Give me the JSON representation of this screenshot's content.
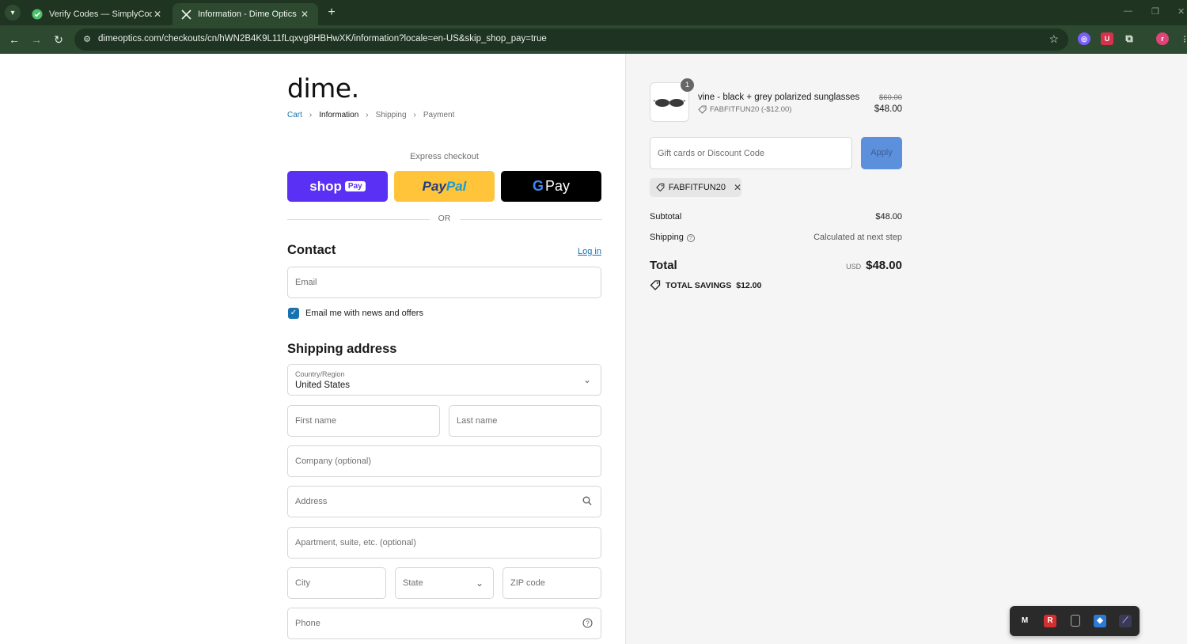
{
  "browser": {
    "tabs": [
      {
        "title": "Verify Codes — SimplyCodes",
        "favicon": "simplycodes-check-icon",
        "active": false
      },
      {
        "title": "Information - Dime Optics - Ch",
        "favicon": "x-logo-icon",
        "active": true
      }
    ],
    "url": "dimeoptics.com/checkouts/cn/hWN2B4K9L11fLqxvg8HBHwXK/information?locale=en-US&skip_shop_pay=true",
    "profile_initial": "r"
  },
  "checkout": {
    "logo": "dime.",
    "breadcrumbs": [
      "Cart",
      "Information",
      "Shipping",
      "Payment"
    ],
    "express_label": "Express checkout",
    "express": {
      "shop_word": "shop",
      "shop_badge": "Pay",
      "paypal_a": "Pay",
      "paypal_b": "Pal",
      "gpay_word": "Pay"
    },
    "or_label": "OR",
    "contact": {
      "heading": "Contact",
      "login_label": "Log in",
      "email_placeholder": "Email",
      "newsletter_label": "Email me with news and offers",
      "newsletter_checked": true
    },
    "shipping": {
      "heading": "Shipping address",
      "country_label": "Country/Region",
      "country_value": "United States",
      "first_name": "First name",
      "last_name": "Last name",
      "company": "Company (optional)",
      "address": "Address",
      "apartment": "Apartment, suite, etc. (optional)",
      "city": "City",
      "state": "State",
      "zip": "ZIP code",
      "phone": "Phone"
    }
  },
  "summary": {
    "item": {
      "name": "vine - black + grey polarized sunglasses",
      "quantity": "1",
      "discount": "FABFITFUN20 (-$12.00)",
      "original_price": "$60.00",
      "price": "$48.00"
    },
    "discount_placeholder": "Gift cards or Discount Code",
    "apply_label": "Apply",
    "applied_code": "FABFITFUN20",
    "subtotal_label": "Subtotal",
    "subtotal_value": "$48.00",
    "shipping_label": "Shipping",
    "shipping_value": "Calculated at next step",
    "total_label": "Total",
    "total_currency": "USD",
    "total_value": "$48.00",
    "savings_label": "TOTAL SAVINGS",
    "savings_value": "$12.00"
  },
  "colors": {
    "chrome_bg": "#1f3522",
    "shop_pay": "#5a31f4",
    "paypal": "#ffc439",
    "link": "#1773b0",
    "apply_button": "#5c8fdc"
  }
}
